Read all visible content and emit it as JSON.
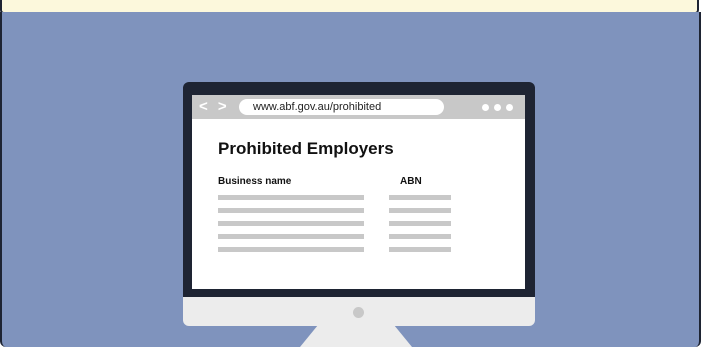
{
  "browser": {
    "url": "www.abf.gov.au/prohibited",
    "nav_arrows": "< >"
  },
  "page": {
    "title": "Prohibited Employers",
    "columns": [
      "Business name",
      "ABN"
    ]
  },
  "colors": {
    "scene_background": "#7f93bd",
    "banner": "#fcf8dc",
    "bezel": "#1e2433",
    "placeholder_lines": "#c8c8c8"
  }
}
